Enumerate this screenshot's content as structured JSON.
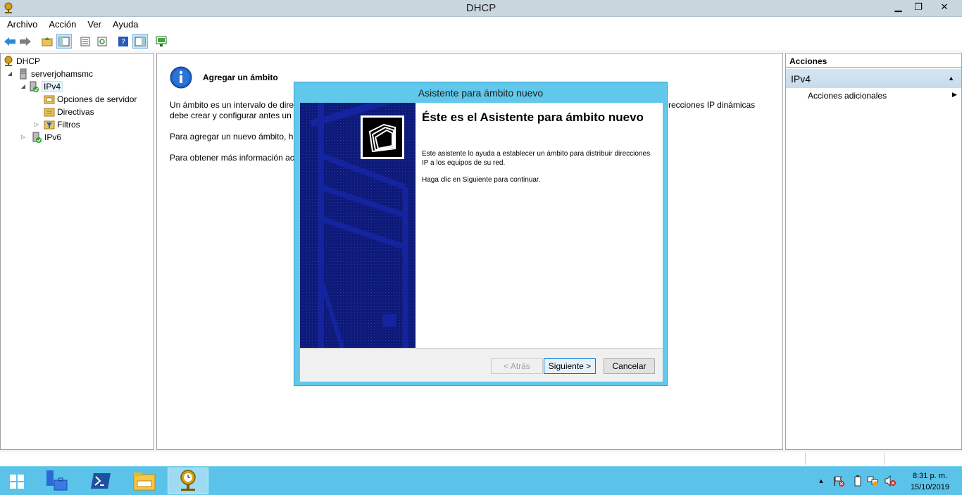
{
  "window": {
    "title": "DHCP",
    "controls": {
      "minimize": "▁",
      "maximize": "❐",
      "close": "✕"
    }
  },
  "menu": [
    "Archivo",
    "Acción",
    "Ver",
    "Ayuda"
  ],
  "toolbar": {
    "icons": [
      "back-icon",
      "forward-icon",
      "up-folder-icon",
      "show-hide-tree-icon",
      "properties-icon",
      "refresh-icon",
      "help-icon",
      "show-action-pane-icon",
      "console-icon"
    ]
  },
  "tree": {
    "root": "DHCP",
    "server": "serverjohamsmc",
    "ipv4": "IPv4",
    "server_options": "Opciones de servidor",
    "policies": "Directivas",
    "filters": "Filtros",
    "ipv6": "IPv6"
  },
  "center": {
    "title": "Agregar un ámbito",
    "line1": "Un ámbito es un intervalo de dire",
    "line1_right": "recciones IP dinámicas",
    "line2": "debe crear y configurar antes un a",
    "para2": "Para agregar un nuevo ámbito, ha",
    "para3": "Para obtener más información ac"
  },
  "actions": {
    "header": "Acciones",
    "section": "IPv4",
    "item": "Acciones adicionales"
  },
  "dialog": {
    "title": "Asistente para ámbito nuevo",
    "heading": "Éste es el Asistente para ámbito nuevo",
    "text1": "Este asistente lo ayuda a establecer un ámbito para distribuir direcciones IP a los equipos de su red.",
    "text2": "Haga clic en Siguiente para continuar.",
    "back_label": "< Atrás",
    "next_label": "Siguiente >",
    "cancel_label": "Cancelar"
  },
  "taskbar": {
    "apps": [
      "server-manager-icon",
      "powershell-icon",
      "file-explorer-icon",
      "dhcp-icon"
    ],
    "time": "8:31 p. m.",
    "date": "15/10/2019",
    "tray_chevron": "▲"
  },
  "colors": {
    "titlebar": "#c8d6de",
    "dialog_frame": "#61c8eb",
    "wizard_sidebar": "#0d1a7a",
    "taskbar": "#5bc3e9"
  }
}
